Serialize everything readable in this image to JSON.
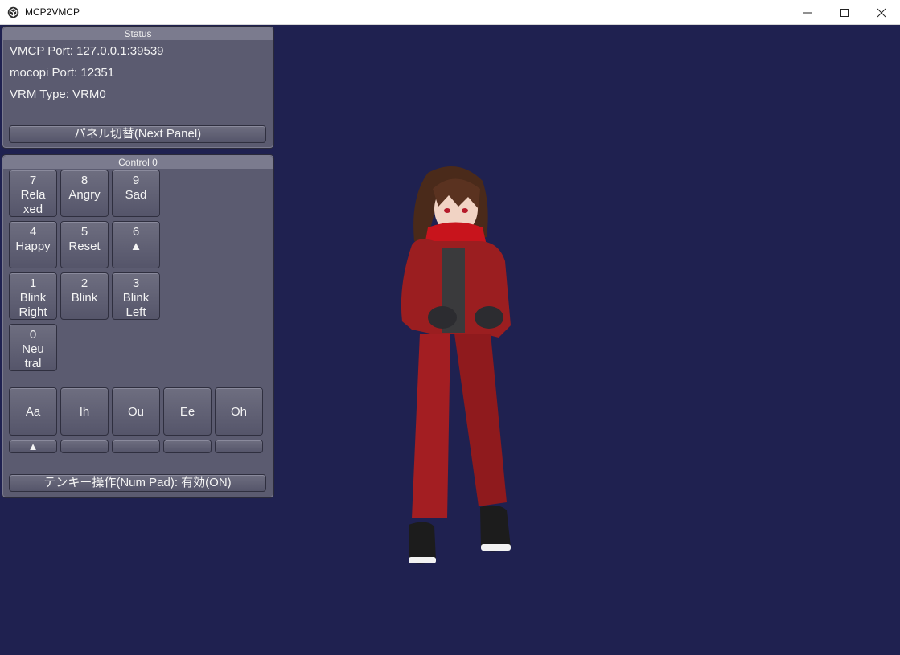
{
  "window": {
    "title": "MCP2VMCP",
    "app_icon": "unity-cube-icon",
    "controls": [
      "minimize-icon",
      "maximize-icon",
      "close-icon"
    ]
  },
  "status_panel": {
    "header": "Status",
    "vmcp_port": "VMCP Port: 127.0.0.1:39539",
    "mocopi_port": "mocopi Port: 12351",
    "vrm_type": "VRM Type: VRM0",
    "next_panel_label": "パネル切替(Next Panel)"
  },
  "control_panel": {
    "header": "Control 0",
    "keys": {
      "k7": {
        "num": "7",
        "l1": "Rela",
        "l2": "xed"
      },
      "k8": {
        "num": "8",
        "l1": "Angry",
        "l2": ""
      },
      "k9": {
        "num": "9",
        "l1": "Sad",
        "l2": ""
      },
      "k4": {
        "num": "4",
        "l1": "Happy",
        "l2": ""
      },
      "k5": {
        "num": "5",
        "l1": "Reset",
        "l2": ""
      },
      "k6": {
        "num": "6",
        "l1": "▲",
        "l2": ""
      },
      "k1": {
        "num": "1",
        "l1": "Blink",
        "l2": "Right"
      },
      "k2": {
        "num": "2",
        "l1": "Blink",
        "l2": ""
      },
      "k3": {
        "num": "3",
        "l1": "Blink",
        "l2": "Left"
      },
      "k0": {
        "num": "0",
        "l1": "Neu",
        "l2": "tral"
      }
    },
    "vowels": [
      "Aa",
      "Ih",
      "Ou",
      "Ee",
      "Oh"
    ],
    "vowel_indicators": [
      "▲",
      "",
      "",
      "",
      ""
    ],
    "numpad_toggle_label": "テンキー操作(Num Pad): 有効(ON)"
  },
  "colors": {
    "background": "#1f2150",
    "panel": "#5b5b70",
    "button": "#66667a",
    "text": "#f3f3f3"
  }
}
